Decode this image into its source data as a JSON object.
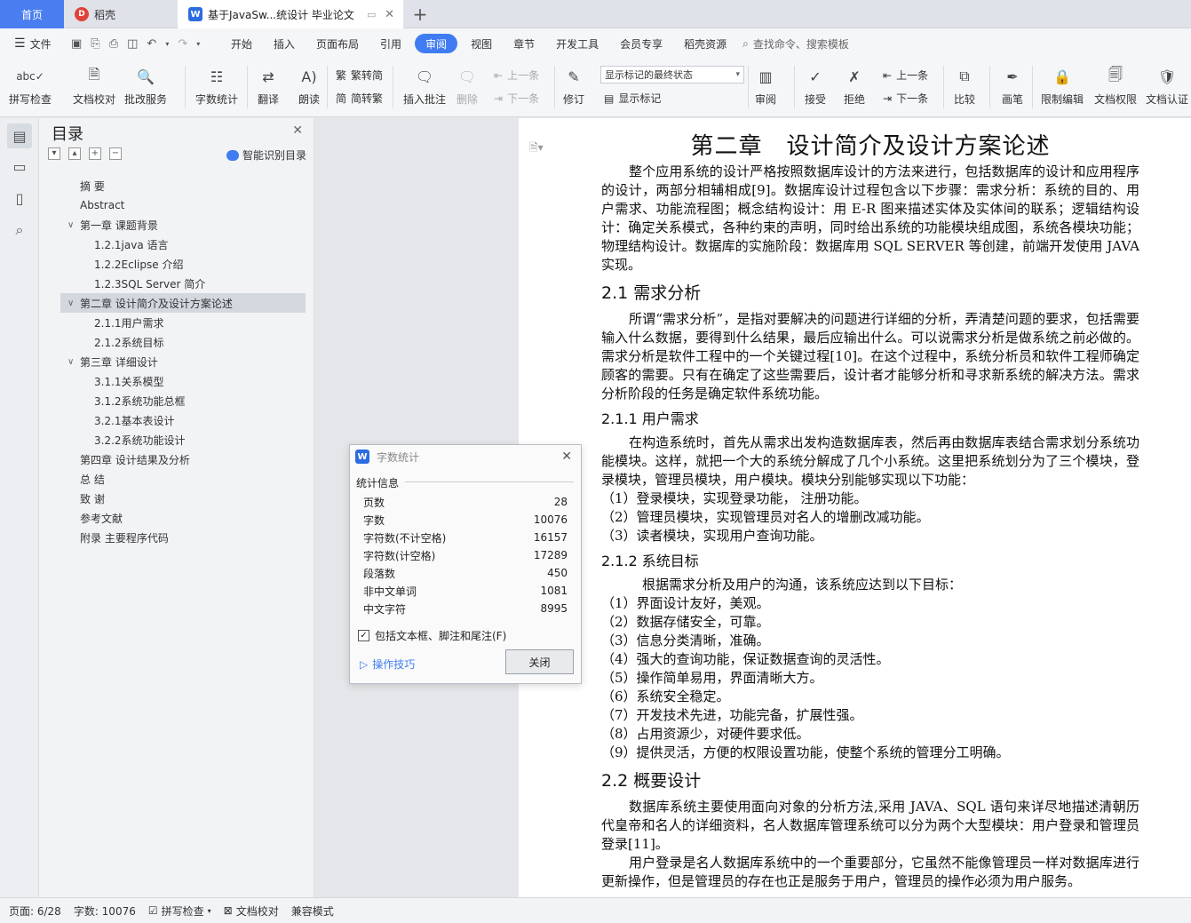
{
  "tabs": {
    "home": "首页",
    "daoke": "稻壳",
    "document": "基于JavaSw...统设计 毕业论文"
  },
  "menu": {
    "file": "文件",
    "items": [
      "开始",
      "插入",
      "页面布局",
      "引用",
      "审阅",
      "视图",
      "章节",
      "开发工具",
      "会员专享",
      "稻壳资源"
    ],
    "search_placeholder": "查找命令、搜索模板"
  },
  "ribbon": {
    "spell_check": "拼写检查",
    "doc_proof": "文档校对",
    "correction_service": "批改服务",
    "word_count": "字数统计",
    "translate": "翻译",
    "read_aloud": "朗读",
    "trad_to_simp": "繁转简",
    "simp_to_trad": "简转繁",
    "insert_comment": "插入批注",
    "delete": "删除",
    "prev_comment": "上一条",
    "next_comment": "下一条",
    "track_changes": "修订",
    "markup_state": "显示标记的最终状态",
    "show_markup": "显示标记",
    "review": "审阅",
    "accept": "接受",
    "reject": "拒绝",
    "prev_change": "上一条",
    "next_change": "下一条",
    "compare": "比较",
    "pen": "画笔",
    "restrict_edit": "限制编辑",
    "doc_permission": "文档权限",
    "doc_cert": "文档认证"
  },
  "toc": {
    "title": "目录",
    "smart_detect": "智能识别目录",
    "items": [
      "摘 要",
      "Abstract",
      "第一章 课题背景",
      "1.2.1java 语言",
      "1.2.2Eclipse 介绍",
      "1.2.3SQL Server 简介",
      "第二章 设计简介及设计方案论述",
      "2.1.1用户需求",
      "2.1.2系统目标",
      "第三章 详细设计",
      "3.1.1关系模型",
      "3.1.2系统功能总框",
      "3.2.1基本表设计",
      "3.2.2系统功能设计",
      "第四章 设计结果及分析",
      "总 结",
      "致 谢",
      "参考文献",
      "附录 主要程序代码"
    ]
  },
  "document": {
    "chapter_title": "第二章　设计简介及设计方案论述",
    "intro": "整个应用系统的设计严格按照数据库设计的方法来进行，包括数据库的设计和应用程序的设计，两部分相辅相成[9]。数据库设计过程包含以下步骤：需求分析：系统的目的、用户需求、功能流程图；概念结构设计：用 E-R 图来描述实体及实体间的联系；逻辑结构设计：确定关系模式，各种约束的声明，同时给出系统的功能模块组成图，系统各模块功能；物理结构设计。数据库的实施阶段：数据库用 SQL SERVER 等创建，前端开发使用 JAVA实现。",
    "s21_title": "2.1  需求分析",
    "s21_text": "所谓“需求分析”，是指对要解决的问题进行详细的分析，弄清楚问题的要求，包括需要输入什么数据，要得到什么结果，最后应输出什么。可以说需求分析是做系统之前必做的。需求分析是软件工程中的一个关键过程[10]。在这个过程中，系统分析员和软件工程师确定顾客的需要。只有在确定了这些需要后，设计者才能够分析和寻求新系统的解决方法。需求分析阶段的任务是确定软件系统功能。",
    "s211_title": "2.1.1  用户需求",
    "s211_text": "在构造系统时，首先从需求出发构造数据库表，然后再由数据库表结合需求划分系统功能模块。这样，就把一个大的系统分解成了几个小系统。这里把系统划分为了三个模块，登录模块，管理员模块，用户模块。模块分别能够实现以下功能：",
    "s211_list": [
      "（1）登录模块，实现登录功能，  注册功能。",
      "（2）管理员模块，实现管理员对名人的增删改减功能。",
      "（3）读者模块，实现用户查询功能。"
    ],
    "s212_title": "2.1.2  系统目标",
    "s212_text": "根据需求分析及用户的沟通，该系统应达到以下目标：",
    "s212_list": [
      "（1）界面设计友好，美观。",
      "（2）数据存储安全，可靠。",
      "（3）信息分类清晰，准确。",
      "（4）强大的查询功能，保证数据查询的灵活性。",
      "（5）操作简单易用，界面清晰大方。",
      "（6）系统安全稳定。",
      "（7）开发技术先进，功能完备，扩展性强。",
      "（8）占用资源少，对硬件要求低。",
      "（9）提供灵活，方便的权限设置功能，使整个系统的管理分工明确。"
    ],
    "s22_title": "2.2  概要设计",
    "s22_text": "数据库系统主要使用面向对象的分析方法,采用 JAVA、SQL 语句来详尽地描述清朝历代皇帝和名人的详细资料，名人数据库管理系统可以分为两个大型模块：用户登录和管理员登录[11]。",
    "s22_text2": "用户登录是名人数据库系统中的一个重要部分，它虽然不能像管理员一样对数据库进行更新操作，但是管理员的存在也正是服务于用户，管理员的操作必须为用户服务。"
  },
  "dialog": {
    "title": "字数统计",
    "section": "统计信息",
    "rows": [
      {
        "label": "页数",
        "value": "28"
      },
      {
        "label": "字数",
        "value": "10076"
      },
      {
        "label": "字符数(不计空格)",
        "value": "16157"
      },
      {
        "label": "字符数(计空格)",
        "value": "17289"
      },
      {
        "label": "段落数",
        "value": "450"
      },
      {
        "label": "非中文单词",
        "value": "1081"
      },
      {
        "label": "中文字符",
        "value": "8995"
      }
    ],
    "checkbox": "包括文本框、脚注和尾注(F)",
    "tips": "操作技巧",
    "close": "关闭"
  },
  "status": {
    "page": "页面: 6/28",
    "words": "字数: 10076",
    "spell": "拼写检查",
    "proof": "文档校对",
    "compat": "兼容模式"
  },
  "colors": {
    "accent": "#3f7cf2",
    "home_tab": "#4a7ef0"
  }
}
